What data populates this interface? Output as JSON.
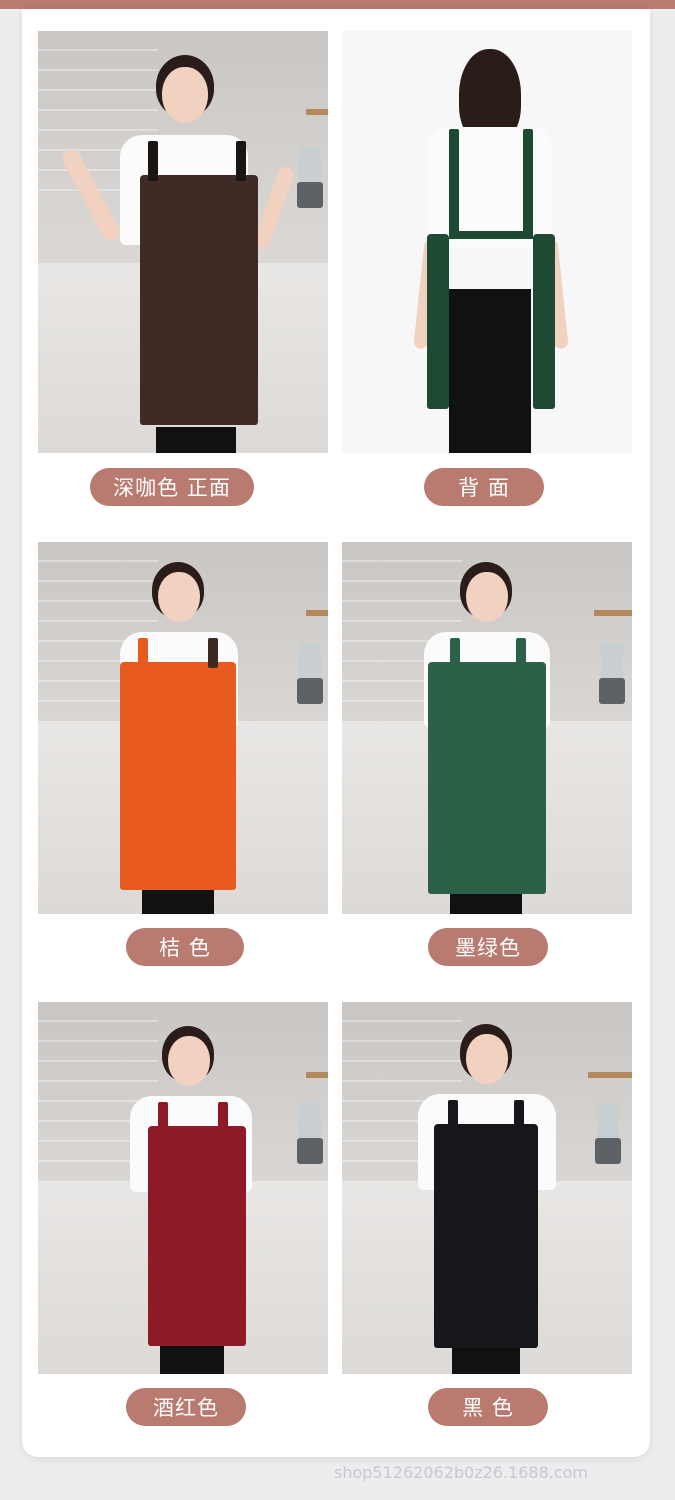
{
  "variants": [
    {
      "label": "深咖色 正面",
      "apron_color": "#3f2a25",
      "view": "front"
    },
    {
      "label": "背 面",
      "apron_color": "#1e4a33",
      "view": "back"
    },
    {
      "label": "桔 色",
      "apron_color": "#e95a1f",
      "view": "front"
    },
    {
      "label": "墨绿色",
      "apron_color": "#2c6147",
      "view": "front"
    },
    {
      "label": "酒红色",
      "apron_color": "#8d1a26",
      "view": "front"
    },
    {
      "label": "黑 色",
      "apron_color": "#16171a",
      "view": "front"
    }
  ],
  "theme": {
    "accent": "#b97a70"
  },
  "watermark": "shop51262062b0z26.1688.com"
}
